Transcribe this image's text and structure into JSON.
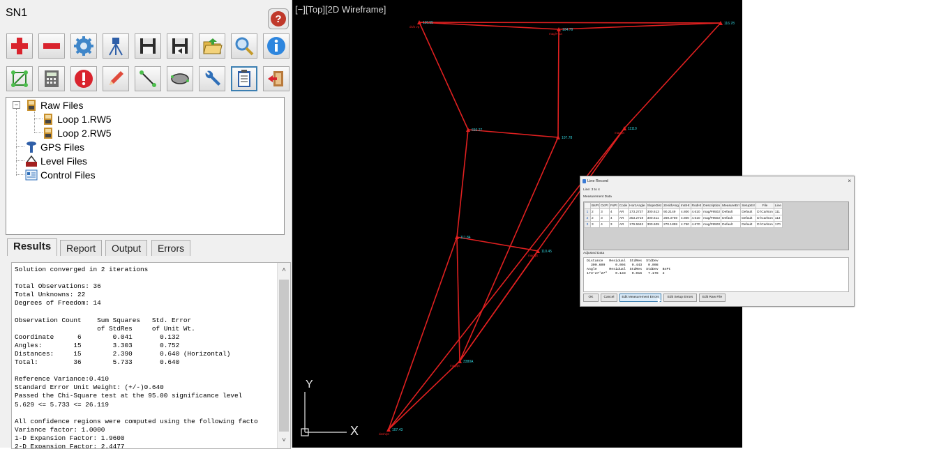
{
  "app": {
    "title": "SN1",
    "help_label": "?"
  },
  "toolbar": {
    "row1": [
      {
        "name": "add-button",
        "icon": "plus-icon"
      },
      {
        "name": "remove-button",
        "icon": "minus-icon"
      },
      {
        "name": "settings-button",
        "icon": "gear-icon"
      },
      {
        "name": "tripod-button",
        "icon": "tripod-icon"
      },
      {
        "name": "save-button",
        "icon": "floppy-icon"
      },
      {
        "name": "save-as-button",
        "icon": "floppy-arrow-icon"
      },
      {
        "name": "open-button",
        "icon": "folder-icon"
      },
      {
        "name": "search-button",
        "icon": "magnifier-icon"
      },
      {
        "name": "info-button",
        "icon": "info-icon"
      }
    ],
    "row2": [
      {
        "name": "network-button",
        "icon": "network-icon"
      },
      {
        "name": "calculator-button",
        "icon": "calculator-icon"
      },
      {
        "name": "errors-button",
        "icon": "alert-icon"
      },
      {
        "name": "edit-button",
        "icon": "pencil-icon"
      },
      {
        "name": "traverse-button",
        "icon": "traverse-icon"
      },
      {
        "name": "ellipse-button",
        "icon": "ellipse-icon"
      },
      {
        "name": "tools-button",
        "icon": "wrench-icon"
      },
      {
        "name": "report-button",
        "icon": "clipboard-icon"
      },
      {
        "name": "exit-button",
        "icon": "exit-icon"
      }
    ]
  },
  "tree": {
    "raw_files": "Raw Files",
    "loop1": "Loop 1.RW5",
    "loop2": "Loop 2.RW5",
    "gps_files": "GPS Files",
    "level_files": "Level Files",
    "control_files": "Control Files",
    "expander": "−"
  },
  "tabs": [
    "Results",
    "Report",
    "Output",
    "Errors"
  ],
  "results": {
    "lines": [
      "Solution converged in 2 iterations",
      "",
      "Total Observations: 36",
      "Total Unknowns: 22",
      "Degrees of Freedom: 14",
      "",
      "Observation Count    Sum Squares   Std. Error",
      "                     of StdRes     of Unit Wt.",
      "Coordinate      6        0.041       0.132",
      "Angles:        15        3.303       0.752",
      "Distances:     15        2.390       0.640 (Horizontal)",
      "Total:         36        5.733       0.640",
      "",
      "Reference Variance:0.410",
      "Standard Error Unit Weight: (+/-)0.640",
      "Passed the Chi-Square test at the 95.00 significance level",
      "5.629 <= 5.733 <= 26.119",
      "",
      "All confidence regions were computed using the following facto",
      "Variance factor: 1.0000",
      "1-D Expansion Factor: 1.9600",
      "2-D Expansion Factor: 2.4477"
    ],
    "scroll_up": "˄",
    "scroll_down": "˅"
  },
  "cad": {
    "viewport_label": "[−][Top][2D Wireframe]",
    "axis_x": "X",
    "axis_y": "Y",
    "line_color": "#e02020",
    "label_color": "#33d6e0",
    "points": [
      {
        "id": "p1",
        "label": "110.55",
        "desc": "ds/s vp"
      },
      {
        "id": "p2",
        "label": "104.79",
        "desc": "mag/# ba"
      },
      {
        "id": "p3",
        "label": "116.78",
        "desc": ""
      },
      {
        "id": "p4",
        "label": "666.27",
        "desc": ""
      },
      {
        "id": "p5",
        "label": "107.78",
        "desc": ""
      },
      {
        "id": "p6",
        "label": "11110",
        "desc": "mag/pt"
      },
      {
        "id": "p7",
        "label": "111.84",
        "desc": ""
      },
      {
        "id": "p8",
        "label": "110.45",
        "desc": "mag/pt"
      },
      {
        "id": "p9",
        "label": "3380A",
        "desc": "mag/pt"
      },
      {
        "id": "p10",
        "label": "107.43",
        "desc": "dash/pt"
      }
    ]
  },
  "dialog": {
    "title": "Line Record",
    "close": "×",
    "line_label": "Line: 3 to 4",
    "measurement_label": "Measurement Data",
    "columns": [
      "",
      "BsPt",
      "OcPt",
      "FsPt",
      "Code",
      "HorzAngle",
      "SlopeDist",
      "ZenithAng",
      "InstHt",
      "RodHt",
      "Description",
      "MeasureErr",
      "SetupErr",
      "File",
      "Line"
    ],
    "rows": [
      [
        "1",
        "2",
        "3",
        "4",
        "AR",
        "173.2727",
        "300.613",
        "90.2149",
        "4.800",
        "4.610",
        "mag/#9502",
        "Default",
        "Default",
        "D:\\Carlson",
        "111"
      ],
      [
        "2",
        "2",
        "3",
        "4",
        "AR",
        "353.2719",
        "300.611",
        "269.3759",
        "4.800",
        "4.610",
        "mag/#9502",
        "Default",
        "Default",
        "D:\\Carlson",
        "113"
      ],
      [
        "3",
        "3",
        "4",
        "3",
        "AR",
        "179.5942",
        "300.609",
        "270.1859",
        "4.750",
        "4.670",
        "mag/#9500",
        "Default",
        "Default",
        "D:\\Carlson",
        "170"
      ]
    ],
    "adjusted_label": "Adjusted Data",
    "adjusted_lines": [
      "Distance   Residual  StdRes  StdDev",
      "  300.609     0.004   0.443   0.008",
      "Angle      Residual  StdRes  StdDev  BsPt",
      "173°27'27\"    0.133   0.016   7.178  2"
    ],
    "buttons": {
      "ok": "OK",
      "cancel": "Cancel",
      "edit_measurement": "Edit Measurement Errors",
      "edit_setup": "Edit Setup Errors",
      "edit_raw": "Edit Raw File"
    }
  }
}
